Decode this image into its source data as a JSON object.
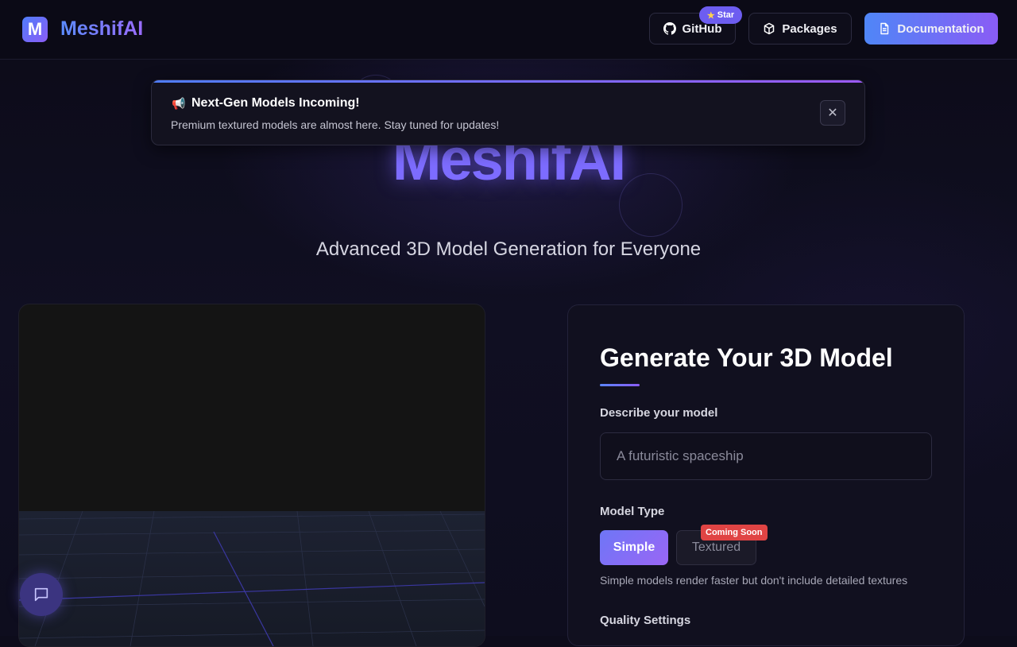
{
  "header": {
    "logo_letter": "M",
    "brand": "MeshifAI",
    "github_label": "GitHub",
    "star_label": "Star",
    "packages_label": "Packages",
    "docs_label": "Documentation"
  },
  "announcement": {
    "title": "Next-Gen Models Incoming!",
    "text": "Premium textured models are almost here. Stay tuned for updates!",
    "icon": "megaphone-icon",
    "close_symbol": "✕"
  },
  "hero": {
    "title": "MeshifAI",
    "subtitle": "Advanced 3D Model Generation for Everyone"
  },
  "form": {
    "title": "Generate Your 3D Model",
    "describe_label": "Describe your model",
    "describe_placeholder": "A futuristic spaceship",
    "model_type_label": "Model Type",
    "simple_label": "Simple",
    "textured_label": "Textured",
    "coming_soon": "Coming Soon",
    "hint": "Simple models render faster but don't include detailed textures",
    "quality_label": "Quality Settings"
  },
  "colors": {
    "accent_blue": "#4f86f7",
    "accent_purple": "#8a5cf5",
    "badge_red": "#e04444"
  }
}
